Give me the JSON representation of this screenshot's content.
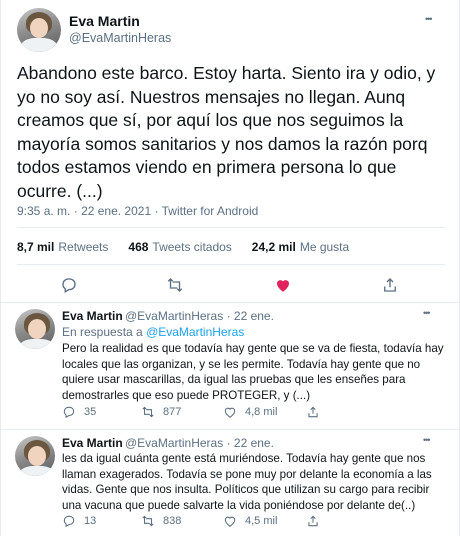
{
  "main_tweet": {
    "author_name": "Eva Martin",
    "author_handle": "@EvaMartinHeras",
    "text": "Abandono este barco. Estoy harta. Siento ira y odio, y yo no soy así. Nuestros mensajes no llegan. Aunq creamos que sí, por aquí los que nos seguimos la mayoría somos sanitarios y nos damos la razón porq todos estamos viendo en primera persona lo que ocurre. (...)",
    "time": "9:35 a. m.",
    "date": "22 ene. 2021",
    "source": "Twitter for Android",
    "separator": "·",
    "retweets_count": "8,7 mil",
    "retweets_label": "Retweets",
    "quotes_count": "468",
    "quotes_label": "Tweets citados",
    "likes_count": "24,2 mil",
    "likes_label": "Me gusta",
    "more": "•••",
    "liked": true
  },
  "replies": [
    {
      "author_name": "Eva Martin",
      "author_handle": "@EvaMartinHeras",
      "date": "· 22 ene.",
      "replying_prefix": "En respuesta a",
      "replying_to": "@EvaMartinHeras",
      "text": "Pero la realidad es que todavía hay gente que se va de fiesta, todavía hay locales que las organizan, y se les permite. Todavía hay gente que no quiere usar mascarillas, da igual las pruebas que les enseñes para demostrarles que eso puede PROTEGER, y (...)",
      "reply_count": "35",
      "retweet_count": "877",
      "like_count": "4,8 mil",
      "more": "•••"
    },
    {
      "author_name": "Eva Martin",
      "author_handle": "@EvaMartinHeras",
      "date": "· 22 ene.",
      "text": "les da igual cuánta gente está muriéndose. Todavía hay gente que nos llaman exagerados. Todavía se pone muy por delante la economía a las vidas. Gente que nos insulta. Políticos que utilizan su cargo para recibir una vacuna que puede salvarte la vida poniéndose por delante de(..)",
      "reply_count": "13",
      "retweet_count": "838",
      "like_count": "4,5 mil",
      "more": "•••"
    }
  ],
  "colors": {
    "text": "#0f1419",
    "muted": "#5b7083",
    "link": "#1da1f2",
    "like": "#e0245e",
    "border": "#e6ecf0"
  },
  "icons": [
    "reply-icon",
    "retweet-icon",
    "like-icon",
    "share-icon",
    "more-icon"
  ]
}
